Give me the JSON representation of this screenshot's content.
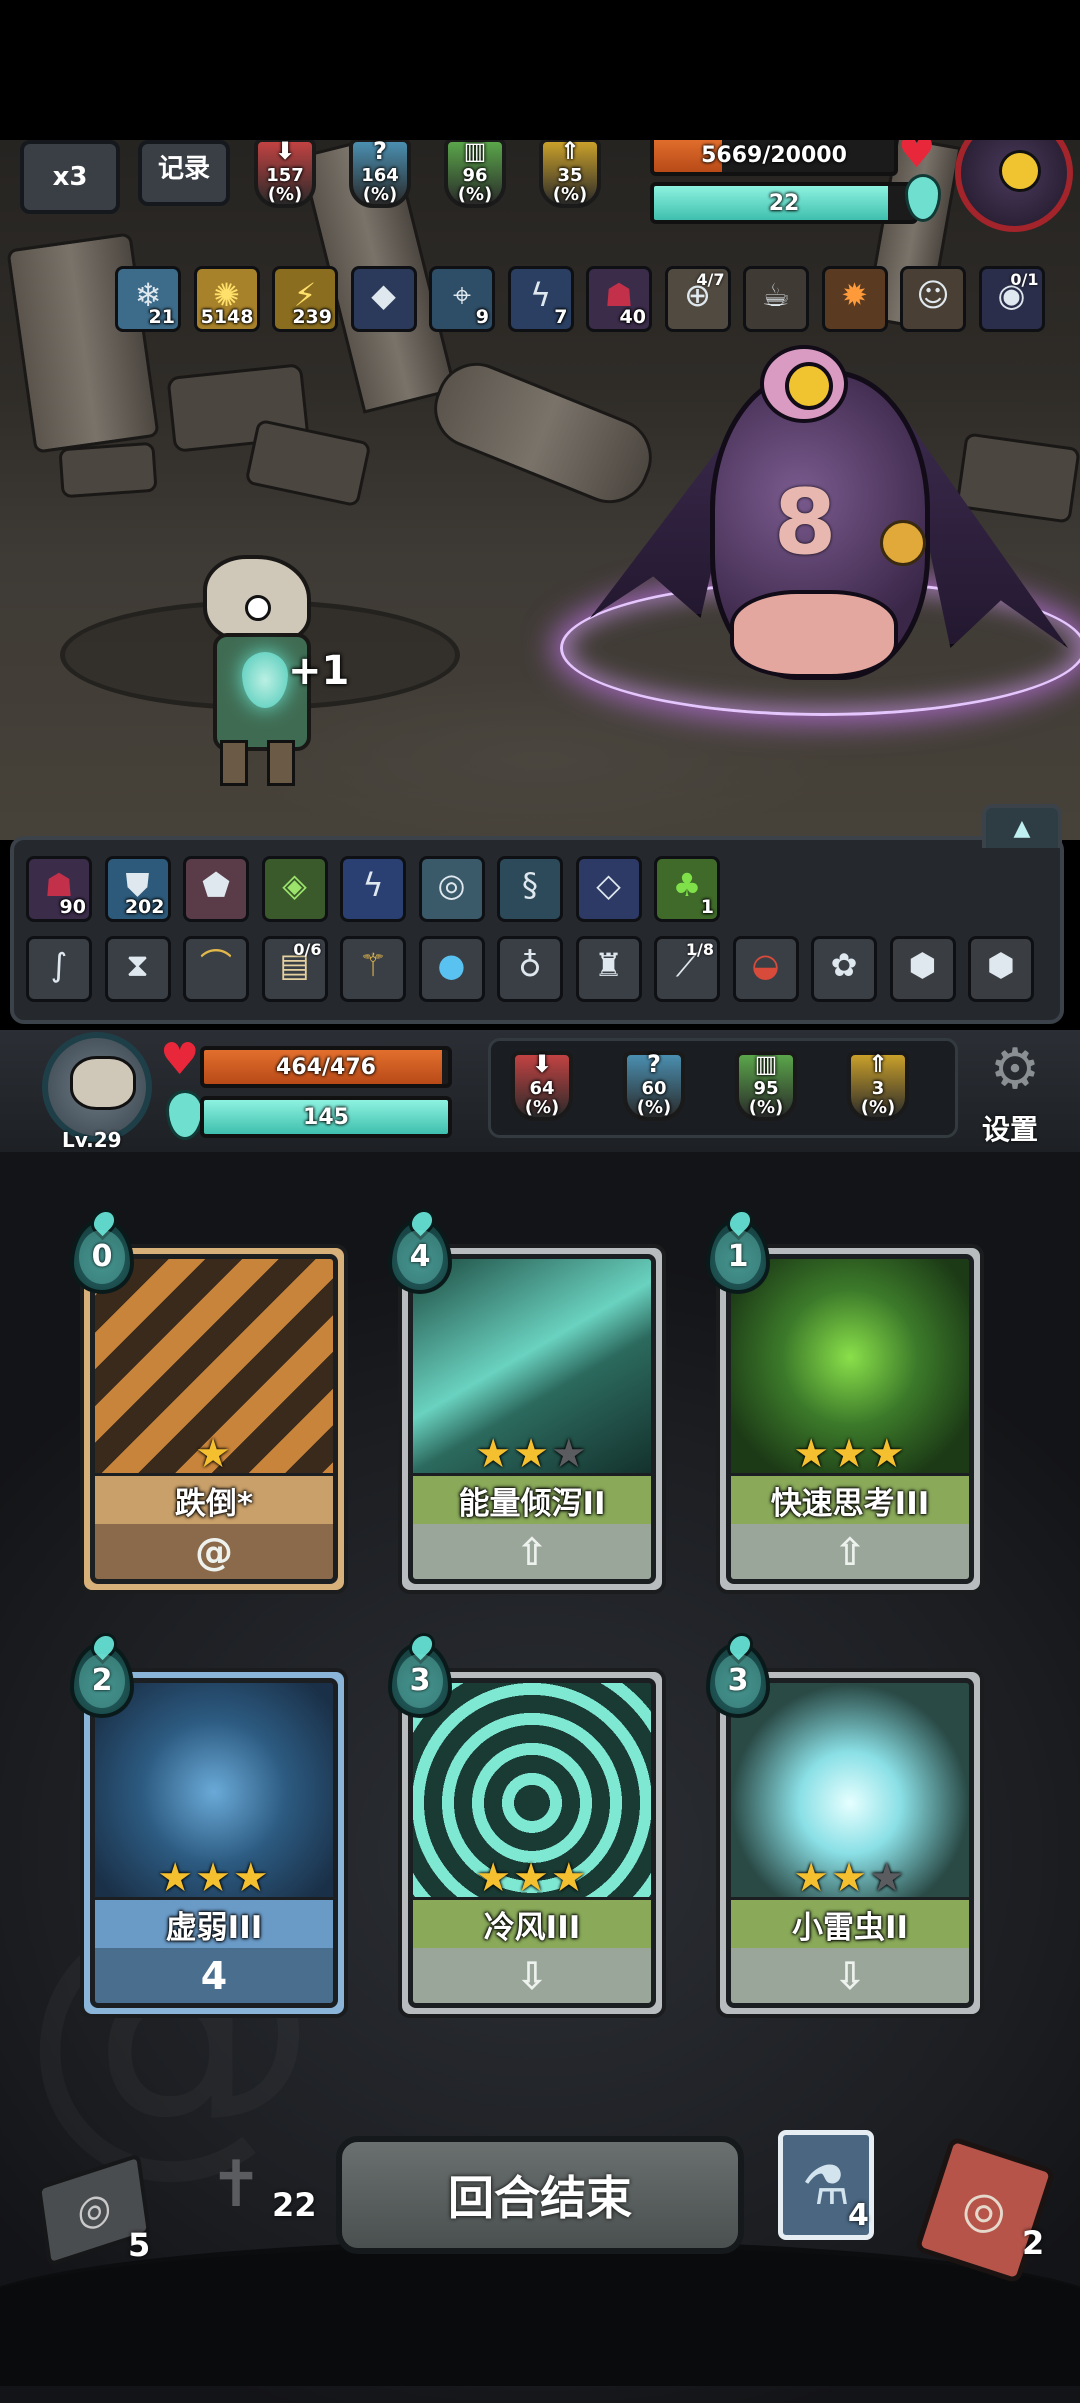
{
  "top_hud": {
    "speed_label": "x3",
    "log_label": "记录",
    "enemy_stats": [
      {
        "value": "157",
        "unit": "(%)",
        "icon": "attack-down-icon",
        "color": "#c24242"
      },
      {
        "value": "164",
        "unit": "(%)",
        "icon": "question-icon",
        "color": "#4a8fb0"
      },
      {
        "value": "96",
        "unit": "(%)",
        "icon": "defense-icon",
        "color": "#5aa64a"
      },
      {
        "value": "35",
        "unit": "(%)",
        "icon": "arrow-up-icon",
        "color": "#c9a02a"
      }
    ],
    "enemy_hp": {
      "text": "5669/20000",
      "fraction": 0.283
    },
    "enemy_energy": {
      "text": "22",
      "fraction": 0.9
    }
  },
  "enemy_status_icons": [
    {
      "icon": "snowflake-icon",
      "count": "21"
    },
    {
      "icon": "lightning-burst-icon",
      "count": "5148"
    },
    {
      "icon": "lightning-icon",
      "count": "239"
    },
    {
      "icon": "crystal-rune-icon",
      "count": ""
    },
    {
      "icon": "crosshair-icon",
      "count": "9"
    },
    {
      "icon": "storm-icon",
      "count": "7"
    },
    {
      "icon": "shadow-figure-icon",
      "count": "40"
    },
    {
      "icon": "compass-icon",
      "count": "",
      "top": "4/7"
    },
    {
      "icon": "teacup-icon",
      "count": ""
    },
    {
      "icon": "fire-orb-icon",
      "count": ""
    },
    {
      "icon": "doll-icon",
      "count": ""
    },
    {
      "icon": "galaxy-icon",
      "count": "",
      "top": "0/1"
    }
  ],
  "battle": {
    "player_gain": "+1"
  },
  "player_buffs": [
    {
      "icon": "shadow-figure-icon",
      "count": "90"
    },
    {
      "icon": "shield-icon",
      "count": "202"
    },
    {
      "icon": "rune-stone-icon",
      "count": ""
    },
    {
      "icon": "green-crystal-icon",
      "count": ""
    },
    {
      "icon": "lightning-vortex-icon",
      "count": ""
    },
    {
      "icon": "whirl-icon",
      "count": ""
    },
    {
      "icon": "swirl-icon",
      "count": ""
    },
    {
      "icon": "blue-gem-icon",
      "count": ""
    },
    {
      "icon": "green-slime-icon",
      "count": "1"
    }
  ],
  "player_relics": [
    {
      "icon": "rope-icon",
      "top": ""
    },
    {
      "icon": "hourglass-icon",
      "top": ""
    },
    {
      "icon": "horn-icon",
      "top": ""
    },
    {
      "icon": "scroll-icon",
      "top": "0/6"
    },
    {
      "icon": "broom-icon",
      "top": ""
    },
    {
      "icon": "water-orb-icon",
      "top": ""
    },
    {
      "icon": "potion-bag-icon",
      "top": ""
    },
    {
      "icon": "hat-icon",
      "top": ""
    },
    {
      "icon": "feather-blade-icon",
      "top": "1/8"
    },
    {
      "icon": "meat-icon",
      "top": ""
    },
    {
      "icon": "nest-icon",
      "top": ""
    },
    {
      "icon": "locked-slot-icon",
      "top": ""
    },
    {
      "icon": "locked-slot-icon",
      "top": ""
    }
  ],
  "player": {
    "level": "Lv.29",
    "hp": {
      "text": "464/476",
      "fraction": 0.975
    },
    "energy": {
      "text": "145",
      "fraction": 1.0
    },
    "stats": [
      {
        "value": "64",
        "unit": "(%)",
        "icon": "attack-down-icon",
        "color": "#c24242"
      },
      {
        "value": "60",
        "unit": "(%)",
        "icon": "question-icon",
        "color": "#4a8fb0"
      },
      {
        "value": "95",
        "unit": "(%)",
        "icon": "defense-icon",
        "color": "#5aa64a"
      },
      {
        "value": "3",
        "unit": "(%)",
        "icon": "arrow-up-icon",
        "color": "#c9a02a"
      }
    ],
    "settings_label": "设置"
  },
  "cards": [
    {
      "cost": "0",
      "name": "跌倒*",
      "stars": 1,
      "max_stars": 1,
      "footer": "@",
      "theme": "curse",
      "art": "falling-figure"
    },
    {
      "cost": "4",
      "name": "能量倾泻II",
      "stars": 2,
      "max_stars": 3,
      "footer": "⇧",
      "theme": "skill",
      "art": "energy-wave"
    },
    {
      "cost": "1",
      "name": "快速思考III",
      "stars": 3,
      "max_stars": 3,
      "footer": "⇧",
      "theme": "skill",
      "art": "thinking-figure"
    },
    {
      "cost": "2",
      "name": "虚弱III",
      "stars": 3,
      "max_stars": 3,
      "footer": "4",
      "theme": "defense",
      "art": "shield"
    },
    {
      "cost": "3",
      "name": "冷风III",
      "stars": 3,
      "max_stars": 3,
      "footer": "⇩",
      "theme": "skill",
      "art": "cold-swirl"
    },
    {
      "cost": "3",
      "name": "小雷虫II",
      "stars": 2,
      "max_stars": 3,
      "footer": "⇩",
      "theme": "skill",
      "art": "thunder-spirit"
    }
  ],
  "bottom": {
    "draw_pile_count": "5",
    "grave_count": "22",
    "end_turn_label": "回合结束",
    "potion_count": "4",
    "discard_pile_count": "2"
  }
}
